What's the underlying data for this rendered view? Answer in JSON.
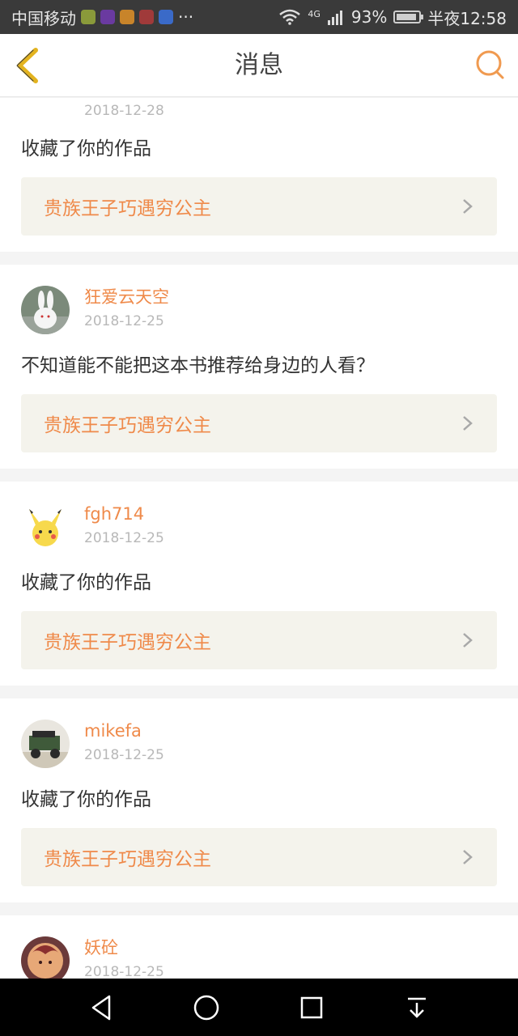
{
  "status_bar": {
    "carrier": "中国移动",
    "more": "···",
    "network": "4G",
    "battery": "93%",
    "time": "半夜12:58"
  },
  "header": {
    "title": "消息",
    "icons": {
      "back": "chevron-left-icon",
      "search": "search-icon"
    }
  },
  "colors": {
    "accent": "#ef8a4a",
    "book_bg": "#f4f3ec"
  },
  "messages": [
    {
      "username": "",
      "date": "2018-12-28",
      "text": "收藏了你的作品",
      "book": "贵族王子巧遇穷公主"
    },
    {
      "username": "狂爱云天空",
      "date": "2018-12-25",
      "text": "不知道能不能把这本书推荐给身边的人看？",
      "book": "贵族王子巧遇穷公主"
    },
    {
      "username": "fgh714",
      "date": "2018-12-25",
      "text": "收藏了你的作品",
      "book": "贵族王子巧遇穷公主"
    },
    {
      "username": "mikefa",
      "date": "2018-12-25",
      "text": "收藏了你的作品",
      "book": "贵族王子巧遇穷公主"
    },
    {
      "username": "妖砼",
      "date": "2018-12-25",
      "text": "",
      "book": ""
    }
  ],
  "nav_bar": {
    "icons": [
      "back-triangle-icon",
      "home-circle-icon",
      "recents-square-icon",
      "notification-down-icon"
    ]
  }
}
